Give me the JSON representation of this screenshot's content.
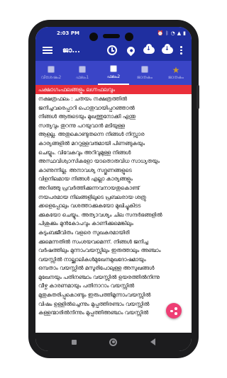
{
  "status_bar": {
    "time": "2:03 PM",
    "indicators": [
      "alarm-icon",
      "bluetooth-icon",
      "wifi-icon",
      "signal-icon",
      "battery-icon"
    ]
  },
  "app_bar": {
    "title": "ജാ...",
    "actions": [
      "clock-icon",
      "location-icon",
      "cloud-download-icon",
      "cloud-download-icon",
      "more-vert-icon"
    ]
  },
  "tabs": [
    {
      "label": "വിശേഷം2",
      "icon": "tab-image-icon",
      "active": false
    },
    {
      "label": "ഫലം1",
      "icon": "tab-image-icon",
      "active": false
    },
    {
      "label": "ഫലം2",
      "icon": "tab-image-icon",
      "active": true
    },
    {
      "label": "ജാതകം",
      "icon": "tab-image-icon",
      "active": false
    },
    {
      "label": "ജാതകം",
      "icon": "star-icon",
      "active": false
    }
  ],
  "content": {
    "heading": "പക്ഷാഗംഫലങ്ങളും ലഗ്നഫലവും",
    "lines": [
      "നക്ഷത്രഫലം : ചതയം നക്ഷത്രത്തിൽ",
      "ജനിച്ചവരെപ്പാറി പൊതുവായിപ്പറഞ്ഞാൽ",
      "നിങ്ങൾ ആരുടെയും മുഖത്തുനോക്കി എന്തു",
      "സത്യവും തുറന്നു പറയുവാൻ മടിയുള്ള",
      "ആളല്ല. അതുകൊണ്ടുതന്നെ നിങ്ങൾ നിസ്സാര",
      "കാര്യങ്ങളിൽ മററുള്ളവരുമായി പിണങ്ങുകയും",
      "ചെയ്യും. വിവേകവും അറിവുമുള്ള നിങ്ങൾ",
      "അസ്ഥവിശ്വാസികളോ യാതൊരുവിധ സാധ്യതയും",
      "കാണുന്നില്ല. അനാവശ്യ സദ്ഗുണങ്ങളുടെ",
      "വിളനിലമായ നിങ്ങൾ എല്ലാ കാര്യങ്ങളും",
      "അറിഞ്ഞു പ്രവർത്തിക്കുന്നവനായതുകൊണ്ട്",
      "നയപരമായ നിലങ്ങളിലൂടെ പ്രബലരായ ശത്രു",
      "ക്കളെപ്പോലും വശത്താക്കുകയോ മുഖിച്ചുകിടട",
      "ക്കുകയോ ചെയ്യും. അത്യാവശ്യം ചില സന്ദർഭങ്ങളിൽ",
      "പിശുക്കും മുൻകോപവും കാണിക്കുമെങ്കിലും",
      "കുടുംബജീവിതം വളരെ സുഖകരമായിരി",
      "ക്കുമെന്നതിൽ സംശയവമെന്ന്.     നിങ്ങൾ ജനിച്ച",
      "വർഷത്തിലും മുന്നാംവയസ്സിലും ഇരുത്താലും അഞ്ചാം",
      "വയസ്സിൽ നാല്ക്കാലികൾമുഖേനമുഖദോഷമായും",
      "ഒമ്പതാം വയസ്സിൽ മസൂരിപോലുള്ള അസുഖങ്ങൾ",
      "മുഖേനയും പതിനഞ്ചാം വയസ്സിൽ ഉയരത്തിൽനിന്നു",
      "വീഴ്ച കാരണമായും പതിനാറാം വയസ്സിൽ",
      "മുതുകുതരിപ്പുകൊണ്ടും ഇരുപത്തിമൂന്നാംവയസ്സിൽ",
      "വിഷം ഉള്ളിൽച്ചെന്നും മുപ്പത്തിരണ്ടാം വയസ്സിൽ",
      "കള്ളന്മാരിൽനിന്നും മുപ്പത്തിഅഞ്ചാം വയസ്സിൽ"
    ]
  },
  "fab": {
    "icon": "share-icon"
  },
  "nav_bar": {
    "icons": [
      "recents-icon",
      "home-icon",
      "back-icon"
    ]
  },
  "colors": {
    "app_bar": "#1f2fa0",
    "tab_bar": "#3a45c7",
    "heading": "#ea2f3a",
    "fab": "#ee3e74",
    "star": "#f5b800"
  }
}
